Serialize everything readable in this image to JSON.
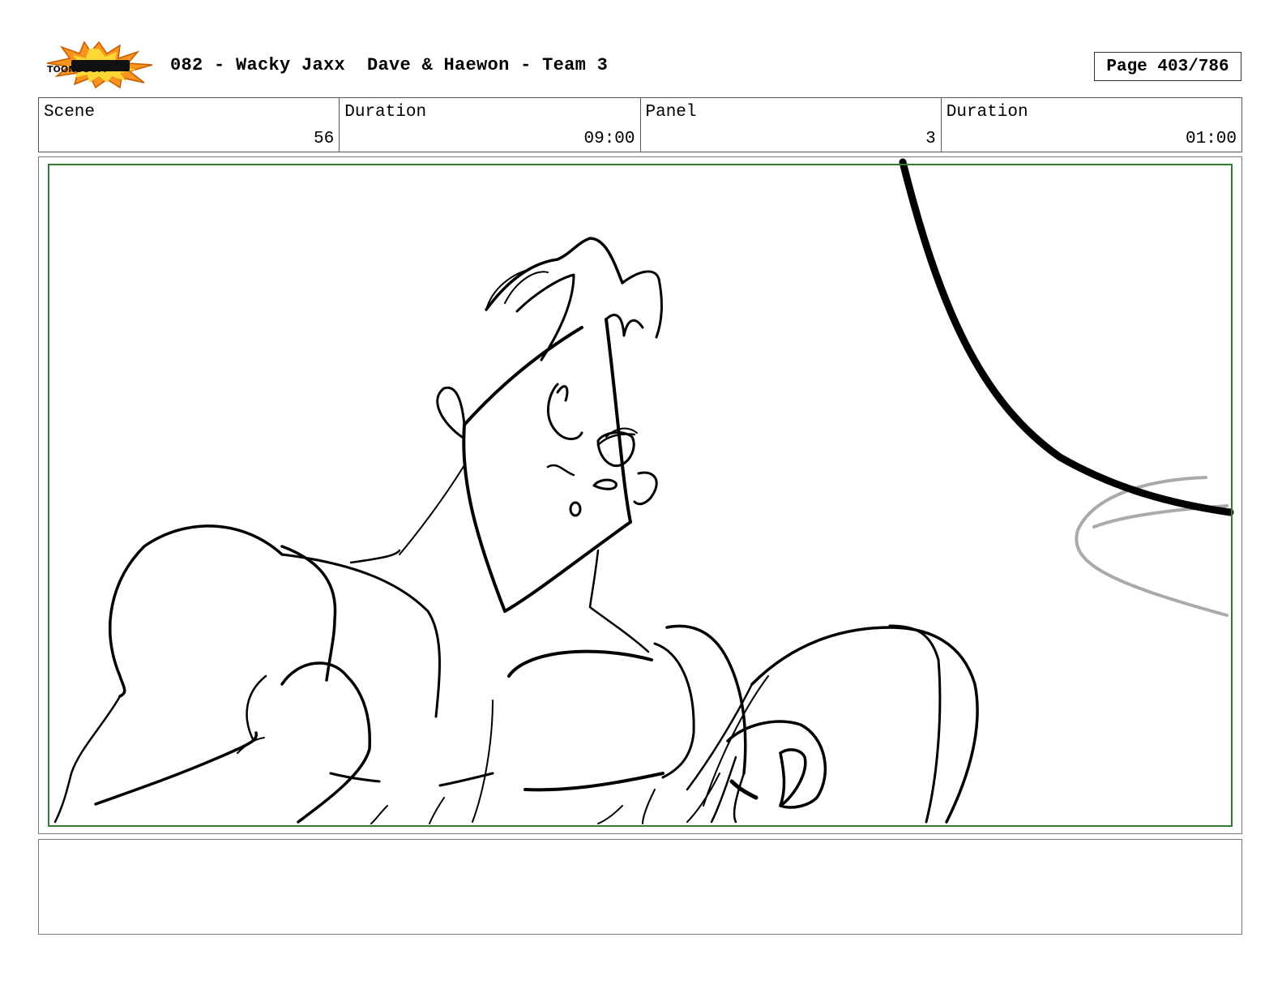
{
  "header": {
    "logo_text": "TOONBOOM",
    "title": "082 - Wacky Jaxx  Dave & Haewon - Team 3",
    "page": "Page 403/786"
  },
  "info": {
    "scene_label": "Scene",
    "scene_value": "56",
    "scene_duration_label": "Duration",
    "scene_duration_value": "09:00",
    "panel_label": "Panel",
    "panel_value": "3",
    "panel_duration_label": "Duration",
    "panel_duration_value": "01:00"
  },
  "panel": {
    "description": "",
    "safe_area_color": "#2e7d32"
  },
  "notes": {
    "text": ""
  }
}
